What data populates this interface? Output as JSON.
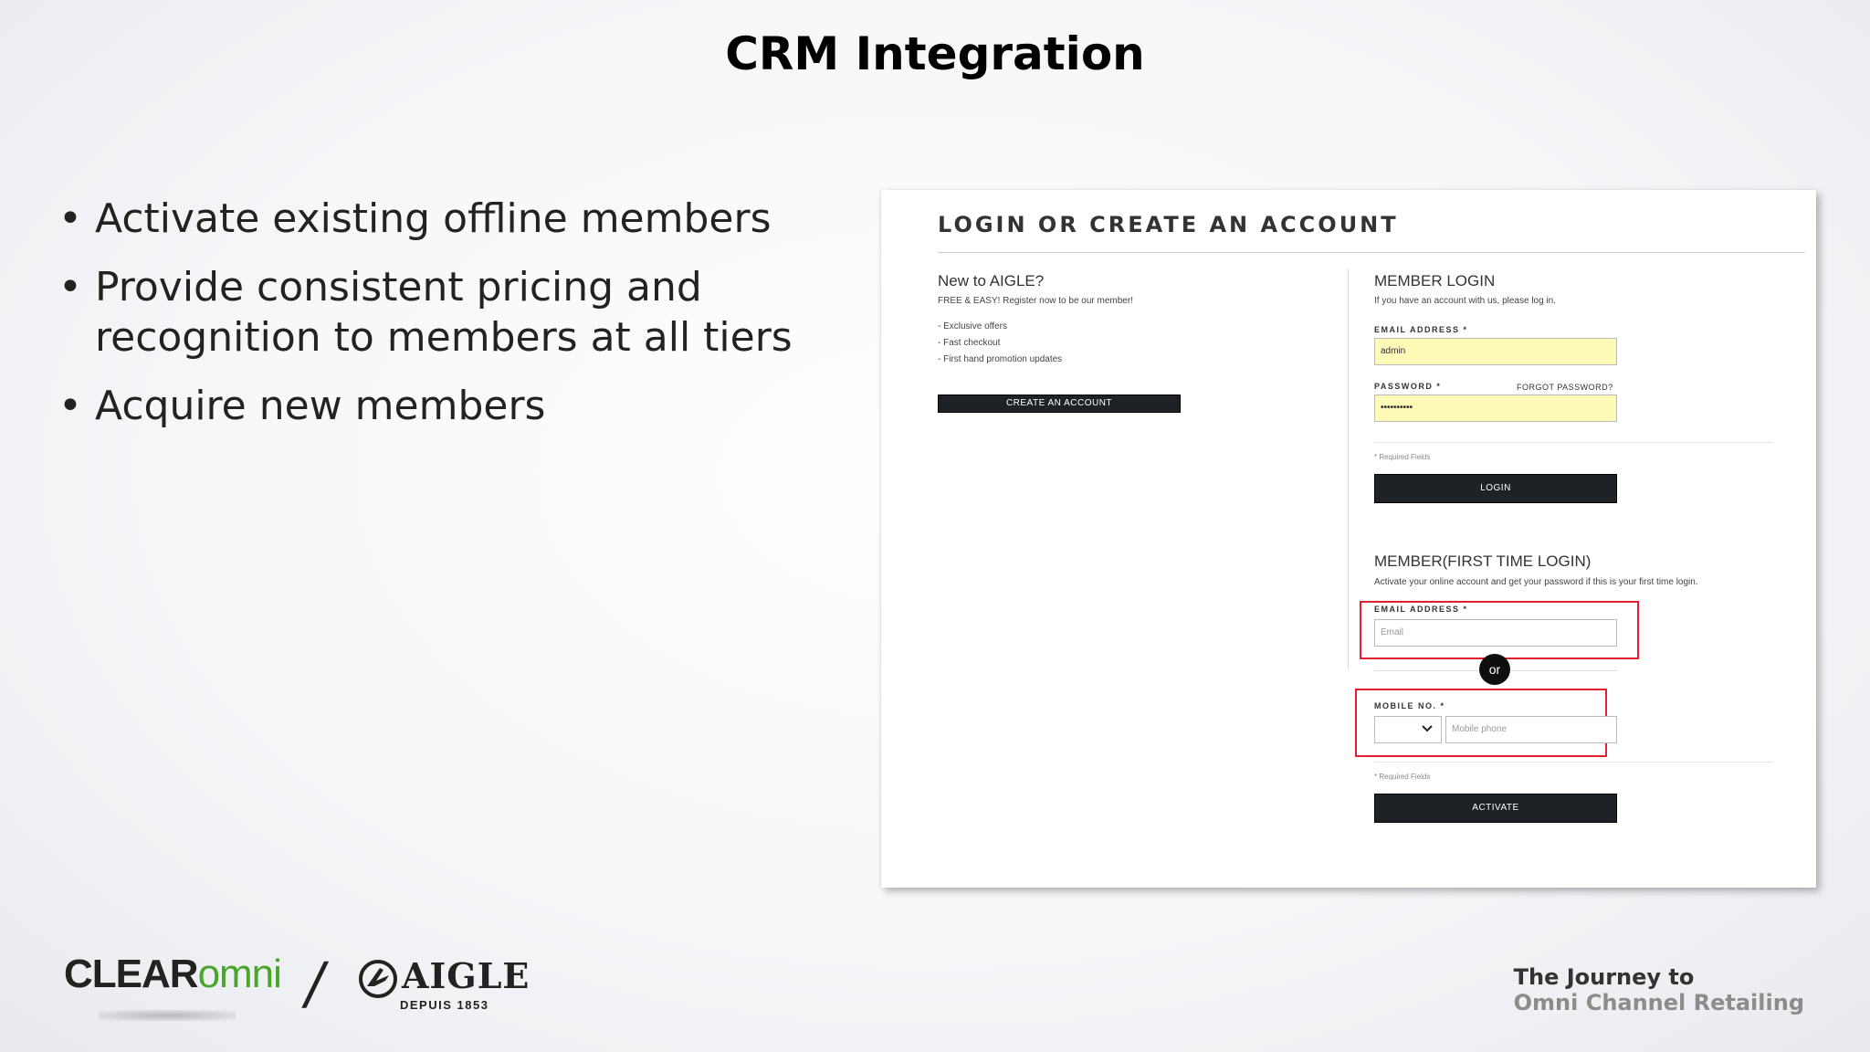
{
  "slide": {
    "title": "CRM Integration",
    "bullets": [
      "Activate existing offline members",
      "Provide consistent pricing and recognition to members at all tiers",
      "Acquire new members"
    ]
  },
  "screenshot": {
    "heading": "LOGIN OR CREATE AN ACCOUNT",
    "new_customer": {
      "title": "New to AIGLE?",
      "subtitle": "FREE & EASY! Register now to be our member!",
      "perks": [
        "- Exclusive offers",
        "- Fast checkout",
        "- First hand promotion updates"
      ],
      "create_button": "CREATE AN ACCOUNT"
    },
    "member_login": {
      "title": "MEMBER LOGIN",
      "subtitle": "If you have an account with us, please log in.",
      "email_label": "EMAIL ADDRESS *",
      "email_value": "admin",
      "password_label": "PASSWORD *",
      "forgot_link": "FORGOT PASSWORD?",
      "password_value": "••••••••••",
      "required_note": "* Required Fields",
      "login_button": "LOGIN"
    },
    "first_time": {
      "title": "MEMBER(FIRST TIME LOGIN)",
      "subtitle": "Activate your online account and get your password if this is your first time login.",
      "email_label": "EMAIL ADDRESS *",
      "email_placeholder": "Email",
      "or_label": "or",
      "mobile_label": "MOBILE NO. *",
      "mobile_placeholder": "Mobile phone",
      "required_note": "* Required Fields",
      "activate_button": "ACTIVATE"
    }
  },
  "footer": {
    "logo_clear": "CLEAR",
    "logo_omni": "omni",
    "separator": "/",
    "aigle_name": "AIGLE",
    "aigle_sub": "DEPUIS 1853",
    "tagline_line1": "The Journey to",
    "tagline_line2": "Omni Channel Retailing"
  },
  "colors": {
    "highlight_red": "#e0202e",
    "autofill_yellow": "#fdf9b6",
    "button_dark": "#1e2226",
    "omni_green": "#4aa62b"
  }
}
